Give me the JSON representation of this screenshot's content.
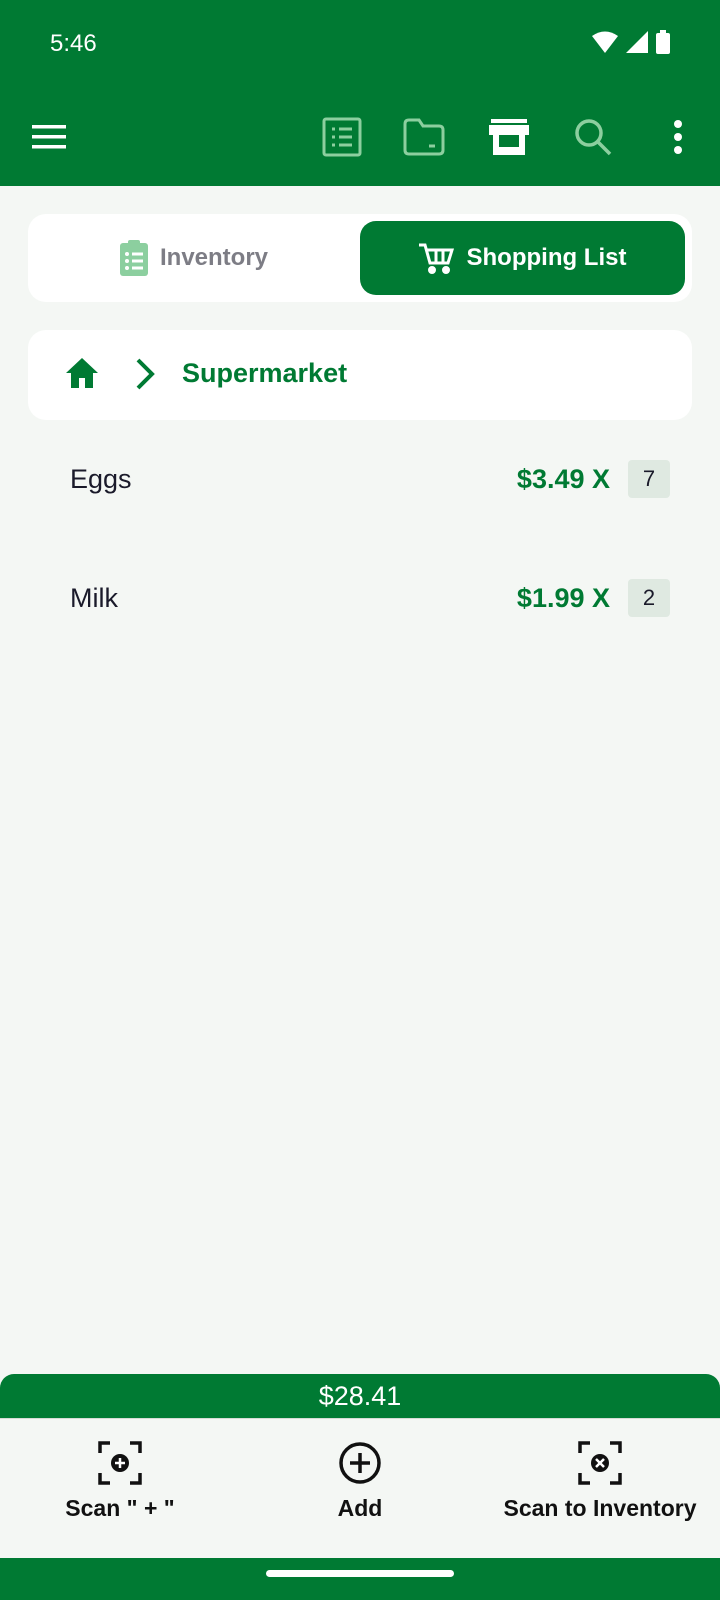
{
  "status": {
    "time": "5:46"
  },
  "tabs": {
    "inventory": "Inventory",
    "shopping": "Shopping List"
  },
  "breadcrumb": {
    "current": "Supermarket"
  },
  "items": [
    {
      "name": "Eggs",
      "price": "$3.49 X",
      "qty": "7"
    },
    {
      "name": "Milk",
      "price": "$1.99 X",
      "qty": "2"
    }
  ],
  "total": "$28.41",
  "bottom_nav": {
    "scan_plus": "Scan \" + \"",
    "add": "Add",
    "scan_inventory": "Scan to Inventory"
  },
  "colors": {
    "brand": "#007a33",
    "background": "#f4f7f4"
  }
}
